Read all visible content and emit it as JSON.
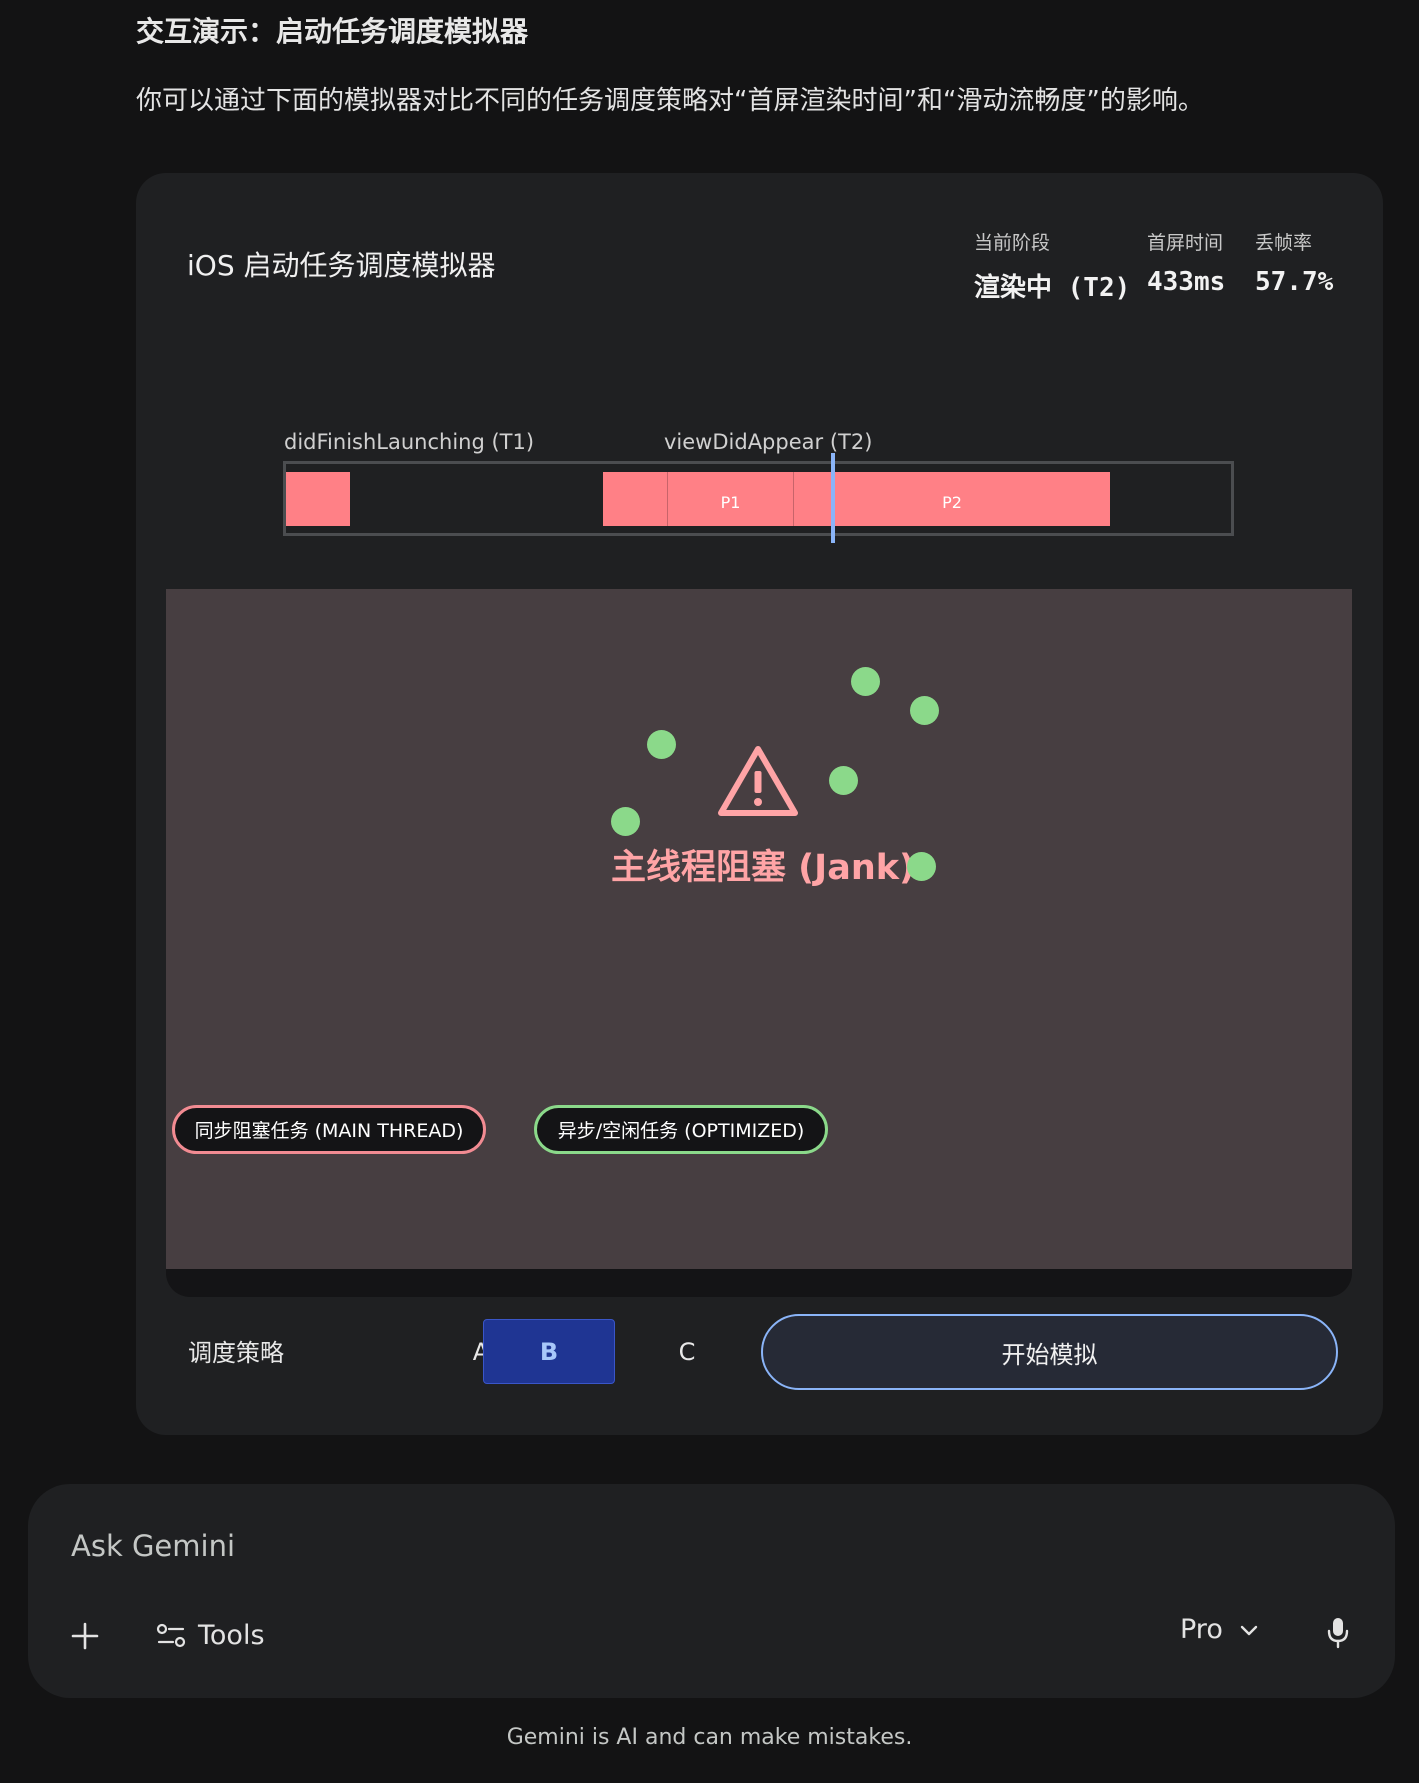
{
  "article": {
    "heading": "交互演示：启动任务调度模拟器",
    "intro": "你可以通过下面的模拟器对比不同的任务调度策略对“首屏渲染时间”和“滑动流畅度”的影响。"
  },
  "simulator": {
    "title": "iOS 启动任务调度模拟器",
    "stats": {
      "phase_label": "当前阶段",
      "phase_value": "渲染中 (T2)",
      "first_screen_label": "首屏时间",
      "first_screen_value": "433ms",
      "drop_rate_label": "丢帧率",
      "drop_rate_value": "57.7%"
    },
    "timeline": {
      "t1_label": "didFinishLaunching (T1)",
      "t2_label": "viewDidAppear (T2)",
      "p1_label": "P1",
      "p2_label": "P2"
    },
    "stage": {
      "jank_text": "主线程阻塞 (Jank)",
      "blocking_label": "同步阻塞任务 (MAIN THREAD)",
      "async_label": "异步/空闲任务 (OPTIMIZED)"
    },
    "controls": {
      "strategy_label": "调度策略",
      "options": [
        "A",
        "B",
        "C"
      ],
      "selected": "B",
      "start_label": "开始模拟"
    },
    "colors": {
      "blocking": "#ff8086",
      "optimized": "#8bd98a",
      "accent": "#8ab4f8"
    }
  },
  "composer": {
    "placeholder": "Ask Gemini",
    "tools_label": "Tools",
    "model_label": "Pro",
    "icons": [
      "plus-icon",
      "tools-icon",
      "chevron-down-icon",
      "mic-icon",
      "warning-icon"
    ]
  },
  "footer": {
    "disclaimer": "Gemini is AI and can make mistakes."
  }
}
